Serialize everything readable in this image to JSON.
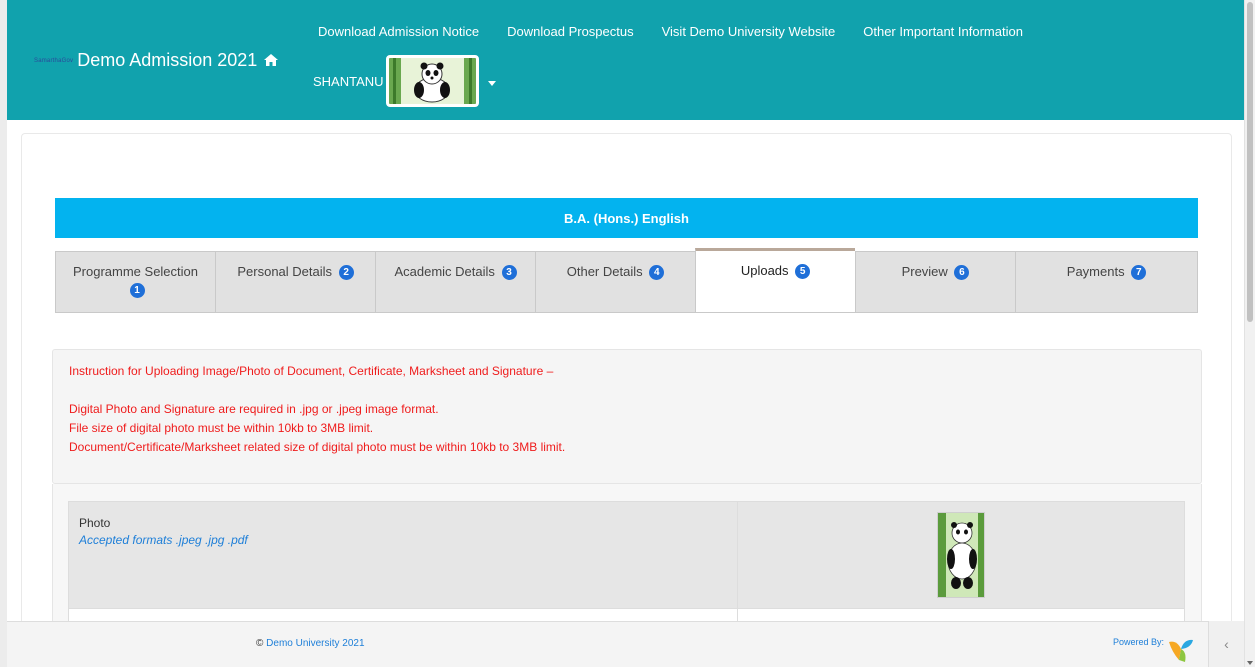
{
  "header": {
    "brand_small": "SamarthaGov",
    "brand_title": "Demo Admission 2021",
    "home_icon": "home-icon",
    "nav": [
      {
        "label": "Download Admission Notice"
      },
      {
        "label": "Download Prospectus"
      },
      {
        "label": "Visit Demo University Website"
      },
      {
        "label": "Other Important Information"
      }
    ],
    "user_name": "SHANTANU",
    "avatar_icon": "panda-avatar-icon"
  },
  "program": {
    "title": "B.A. (Hons.) English"
  },
  "tabs": [
    {
      "label": "Programme Selection",
      "badge": "1"
    },
    {
      "label": "Personal Details",
      "badge": "2"
    },
    {
      "label": "Academic Details",
      "badge": "3"
    },
    {
      "label": "Other Details",
      "badge": "4"
    },
    {
      "label": "Uploads",
      "badge": "5",
      "active": true
    },
    {
      "label": "Preview",
      "badge": "6"
    },
    {
      "label": "Payments",
      "badge": "7"
    }
  ],
  "instructions": {
    "heading": "Instruction for Uploading Image/Photo of Document, Certificate, Marksheet and Signature –",
    "lines": [
      "Digital Photo and Signature are required in .jpg or .jpeg image format.",
      "File size of digital photo must be within 10kb to 3MB limit.",
      "Document/Certificate/Marksheet related size of digital photo must be within 10kb to 3MB limit."
    ]
  },
  "uploads": [
    {
      "title": "Photo",
      "formats": "Accepted formats .jpeg .jpg .pdf"
    }
  ],
  "footer": {
    "copyright_symbol": "©",
    "copyright_link": "Demo University 2021",
    "powered_by": "Powered By:",
    "collapse_icon": "‹"
  },
  "colors": {
    "header": "#11a2ad",
    "program_bar": "#03b3ef",
    "badge": "#1f6fd8",
    "instruction_text": "#ef1c1c",
    "link": "#1e7fd8"
  }
}
